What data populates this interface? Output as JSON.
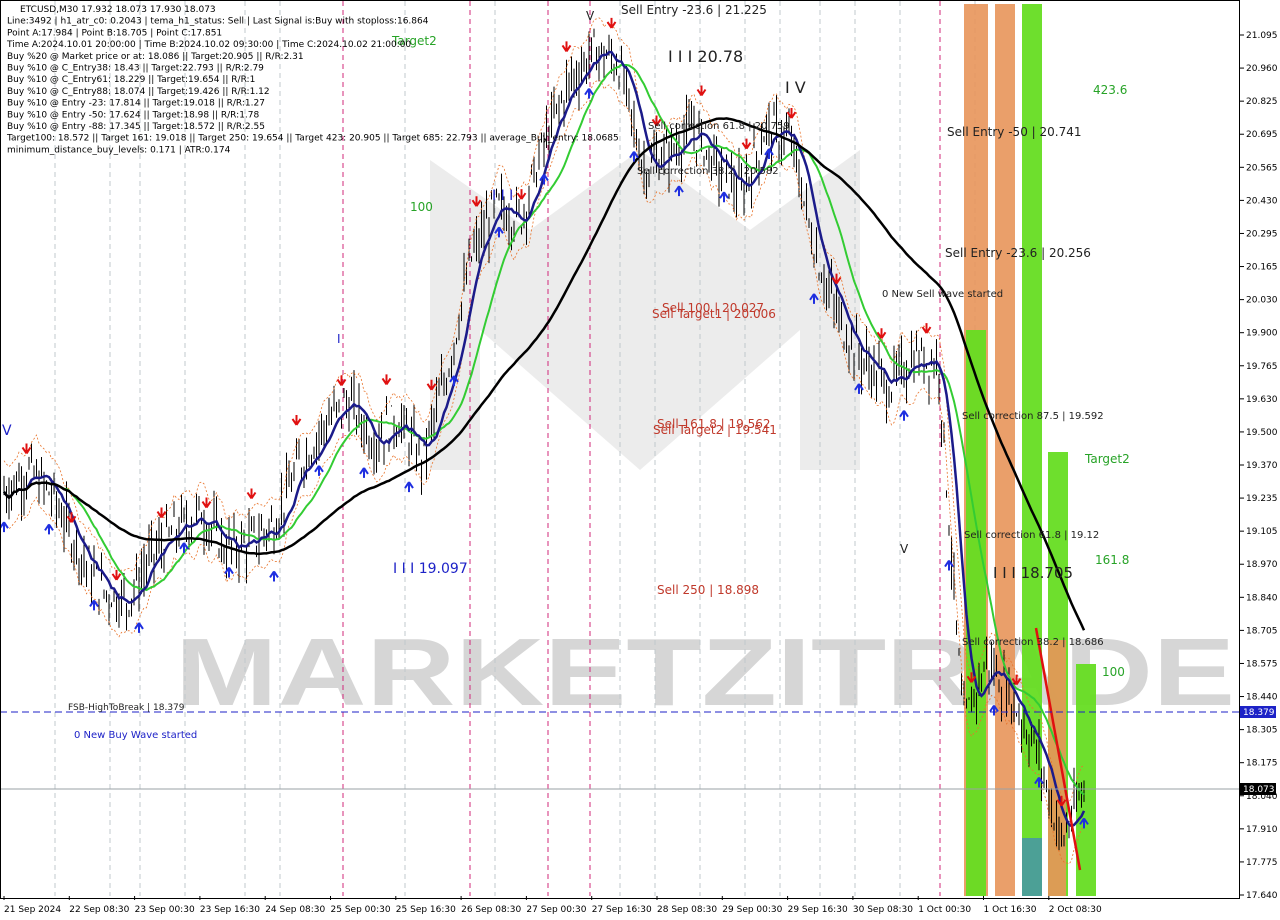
{
  "info_lines": [
    "ETCUSD,M30  17.932 18.073 17.930 18.073",
    "Line:3492 | h1_atr_c0: 0.2043 | tema_h1_status: Sell | Last Signal is:Buy with stoploss:16.864",
    "Point A:17.984 | Point B:18.705 | Point C:17.851",
    "Time A:2024.10.01 20:00:00 | Time B:2024.10.02 09:30:00 | Time C:2024.10.02 21:00:00",
    "Buy %20 @ Market price or at: 18.086 || Target:20.905 || R/R:2.31",
    "Buy %10 @ C_Entry38: 18.43 || Target:22.793 || R/R:2.79",
    "Buy %10 @ C_Entry61: 18.229 || Target:19.654 || R/R:1",
    "Buy %10 @ C_Entry88: 18.074 || Target:19.426 || R/R:1.12",
    "Buy %10 @ Entry -23: 17.814 || Target:19.018 || R/R:1.27",
    "Buy %10 @ Entry -50: 17.624 || Target:18.98 || R/R:1.78",
    "Buy %10 @ Entry -88: 17.345 || Target:18.572 || R/R:2.55",
    "Target100: 18.572 || Target 161: 19.018 || Target 250: 19.654 || Target 423: 20.905 || Target 685: 22.793 || average_Buy_entry: 18.0685",
    "minimum_distance_buy_levels: 0.171 | ATR:0.174"
  ],
  "watermark": "MARKETZITRADE",
  "colors": {
    "background": "#ffffff",
    "candles": "#000000",
    "ema_slow": "#000000",
    "ema_mid": "#1b1b8a",
    "ema_fast": "#33cc33",
    "green_band": "#66dd22",
    "orange_band": "#e8955a",
    "buy_arrow": "#1f2fe0",
    "sell_arrow": "#e01010",
    "dashed_line": "#1d22c7",
    "price_tag": "#1d22c7"
  },
  "current_price": "18.073",
  "fsb_price_tag": "18.379",
  "chart_data": {
    "type": "candlestick",
    "symbol": "ETCUSD",
    "timeframe": "M30",
    "ylim": [
      17.64,
      21.08
    ],
    "y_ticks": [
      "21.095",
      "20.960",
      "20.825",
      "20.695",
      "20.565",
      "20.430",
      "20.295",
      "20.165",
      "20.030",
      "19.900",
      "19.765",
      "19.630",
      "19.500",
      "19.370",
      "19.235",
      "19.105",
      "18.970",
      "18.840",
      "18.705",
      "18.575",
      "18.440",
      "18.305",
      "18.175",
      "18.040",
      "17.910",
      "17.775",
      "17.640"
    ],
    "x_ticks": [
      "21 Sep 2024",
      "22 Sep 08:30",
      "23 Sep 00:30",
      "23 Sep 16:30",
      "24 Sep 08:30",
      "25 Sep 00:30",
      "25 Sep 16:30",
      "26 Sep 08:30",
      "27 Sep 00:30",
      "27 Sep 16:30",
      "28 Sep 08:30",
      "29 Sep 00:30",
      "29 Sep 16:30",
      "30 Sep 08:30",
      "1 Oct 00:30",
      "1 Oct 16:30",
      "2 Oct 08:30"
    ],
    "price_path": [
      19.2,
      19.28,
      19.18,
      18.98,
      18.82,
      18.78,
      18.95,
      19.05,
      19.12,
      18.98,
      19.0,
      19.08,
      19.3,
      19.45,
      19.55,
      19.4,
      19.48,
      19.32,
      19.65,
      20.1,
      20.3,
      20.25,
      20.55,
      20.78,
      20.9,
      20.85,
      20.45,
      20.5,
      20.6,
      20.45,
      20.35,
      20.6,
      20.55,
      20.12,
      19.85,
      19.7,
      19.6,
      19.72,
      19.7,
      18.3,
      18.55,
      18.4,
      18.2,
      17.85,
      18.07
    ],
    "annotations": [
      {
        "text": "Sell Entry -23.6 | 21.225",
        "style": "dark"
      },
      {
        "text": "I I I 20.78",
        "style": "dark"
      },
      {
        "text": "I V",
        "style": "dark"
      },
      {
        "text": "V",
        "style": "dark"
      },
      {
        "text": "Sell Entry -50 | 20.741",
        "style": "dark"
      },
      {
        "text": "Sell Entry -23.6 | 20.256",
        "style": "dark"
      },
      {
        "text": "0 New Sell wave started",
        "style": "dark"
      },
      {
        "text": "Sell correction 61.8 | 20.759",
        "style": "dark"
      },
      {
        "text": "Sell correction 38.2 | 20.582",
        "style": "dark"
      },
      {
        "text": "Sell 100 | 20.027",
        "style": "red"
      },
      {
        "text": "Sell Target1 | 20.006",
        "style": "red"
      },
      {
        "text": "Sell 161.8 | 19.562",
        "style": "red"
      },
      {
        "text": "Sell Target2 | 19.541",
        "style": "red"
      },
      {
        "text": "Sell  250 | 18.898",
        "style": "red"
      },
      {
        "text": "I I I 19.097",
        "style": "blue"
      },
      {
        "text": "I I I 18.705",
        "style": "dark"
      },
      {
        "text": "Sell correction 87.5 | 19.592",
        "style": "dark"
      },
      {
        "text": "Sell correction 61.8 | 19.12",
        "style": "dark"
      },
      {
        "text": "Sell correction 38.2 | 18.686",
        "style": "dark"
      },
      {
        "text": "FSB-HighToBreak  |  18.379",
        "style": "dark"
      },
      {
        "text": "0 New Buy Wave started",
        "style": "blue"
      },
      {
        "text": "Target2",
        "style": "green"
      },
      {
        "text": "100",
        "style": "green"
      },
      {
        "text": "423.6",
        "style": "green"
      },
      {
        "text": "161.8",
        "style": "green"
      },
      {
        "text": "I I I",
        "style": "blue"
      },
      {
        "text": "I",
        "style": "blue"
      },
      {
        "text": "V",
        "style": "blue"
      }
    ]
  }
}
